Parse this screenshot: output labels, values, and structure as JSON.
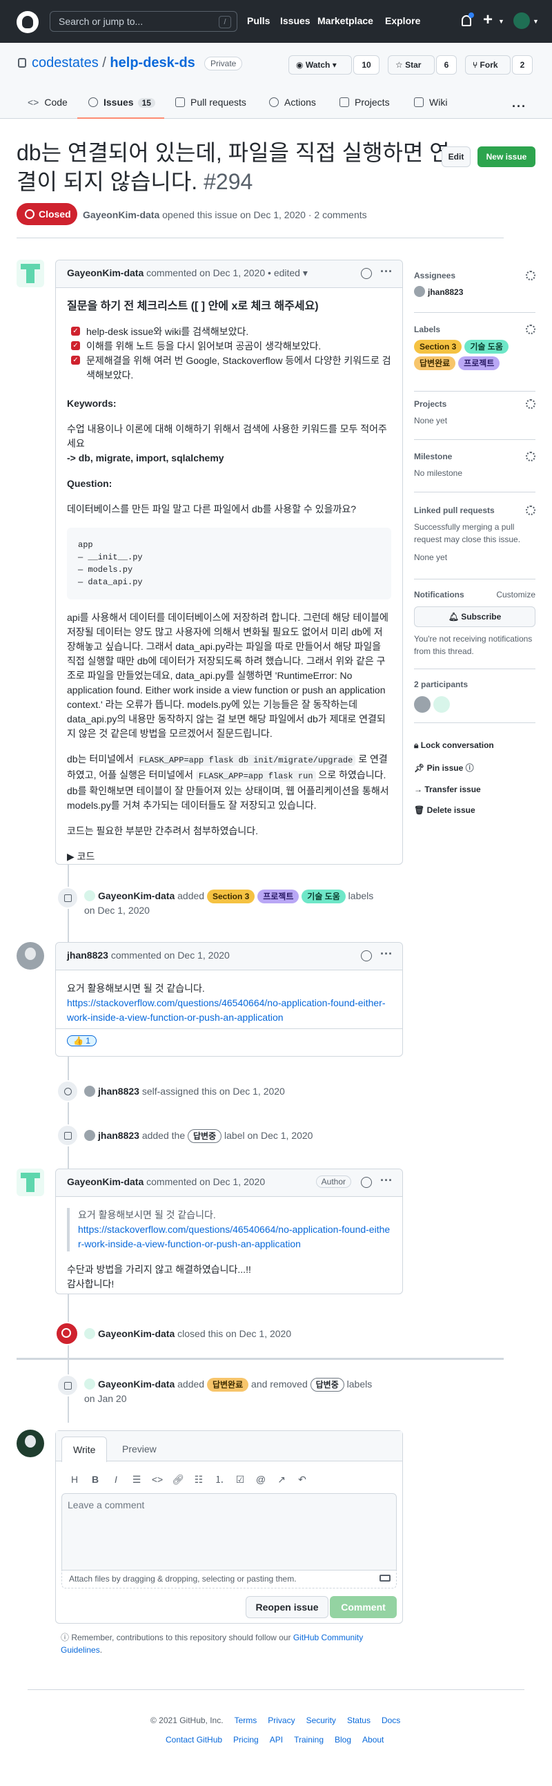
{
  "header": {
    "search_placeholder": "Search or jump to...",
    "slash": "/",
    "nav": [
      "Pulls",
      "Issues",
      "Marketplace",
      "Explore"
    ],
    "plus": "+"
  },
  "repo": {
    "owner": "codestates",
    "sep": "/",
    "name": "help-desk-ds",
    "visibility": "Private",
    "watch": "Watch",
    "watch_count": "10",
    "star": "Star",
    "star_count": "6",
    "fork": "Fork",
    "fork_count": "2"
  },
  "tabs": {
    "code": "Code",
    "issues": "Issues",
    "issues_count": "15",
    "pulls": "Pull requests",
    "actions": "Actions",
    "projects": "Projects",
    "wiki": "Wiki",
    "more": "···"
  },
  "issue": {
    "title": "db는 연결되어 있는데, 파일을 직접 실행하면 연결이 되지 않습니다.",
    "number": "#294",
    "edit": "Edit",
    "new_issue": "New issue",
    "state": "Closed",
    "author": "GayeonKim-data",
    "opened_text": "opened this issue on Dec 1, 2020 · 2 comments"
  },
  "c1": {
    "author": "GayeonKim-data",
    "meta": "commented on Dec 1, 2020 • edited ▾",
    "h": "질문을 하기 전 체크리스트 ([ ] 안에 x로 체크 해주세요)",
    "checks": [
      "help-desk issue와 wiki를 검색해보았다.",
      "이해를 위해 노트 등을 다시 읽어보며 공곰이 생각해보았다.",
      "문제해결을 위해 여러 번 Google, Stackoverflow 등에서 다양한 키워드로 검색해보았다."
    ],
    "kw_label": "Keywords:",
    "kw_text": "수업 내용이나 이론에 대해 이해하기 위해서 검색에 사용한 키워드를 모두 적어주세요",
    "kw_values": "-> db, migrate, import, sqlalchemy",
    "q_label": "Question:",
    "q_text": "데이터베이스를 만든 파일 말고 다른 파일에서 db를 사용할 수 있을까요?",
    "code": "app\n— __init__.py\n— models.py\n— data_api.py",
    "para1": "api를 사용해서 데이터를 데이터베이스에 저장하려 합니다. 그런데 해당 테이블에 저장될 데이터는 양도 많고 사용자에 의해서 변화될 필요도 없어서 미리 db에 저장해놓고 싶습니다. 그래서 data_api.py라는 파일을 따로 만들어서 해당 파일을 직접 실행할 때만 db에 데이터가 저장되도록 하려 했습니다. 그래서 위와 같은 구조로 파일을 만들었는데요, data_api.py를 실행하면 'RuntimeError: No application found. Either work inside a view function or push an application context.' 라는 오류가 뜹니다. models.py에 있는 기능들은 잘 동작하는데 data_api.py의 내용만 동작하지 않는 걸 보면 해당 파일에서 db가 제대로 연결되지 않은 것 같은데 방법을 모르겠어서 질문드립니다.",
    "p2a": "db는 터미널에서",
    "p2code1": "FLASK_APP=app flask db init/migrate/upgrade",
    "p2b": "로 연결하였고, 어플 실행은 터미널에서",
    "p2code2": "FLASK_APP=app flask run",
    "p2c": "으로 하였습니다. db를 확인해보면 테이블이 잘 만들어져 있는 상태이며, 웹 어플리케이션을 통해서 models.py를 거쳐 추가되는 데이터들도 잘 저장되고 있습니다.",
    "p3": "코드는 필요한 부분만 간추려서 첨부하였습니다.",
    "details": "▶ 코드"
  },
  "sidebar": {
    "assignees": "Assignees",
    "assignee": "jhan8823",
    "labels": "Labels",
    "label_list": [
      {
        "text": "Section 3",
        "bg": "#f5c242",
        "fg": "#3d2c00"
      },
      {
        "text": "기술 도움",
        "bg": "#6ee7c8",
        "fg": "#0b3d2e"
      },
      {
        "text": "답변완료",
        "bg": "#f7c56b",
        "fg": "#3d2c00"
      },
      {
        "text": "프로젝트",
        "bg": "#b9a7f5",
        "fg": "#2a1a66"
      }
    ],
    "projects": "Projects",
    "projects_val": "None yet",
    "milestone": "Milestone",
    "milestone_val": "No milestone",
    "linked": "Linked pull requests",
    "linked_desc": "Successfully merging a pull request may close this issue.",
    "linked_val": "None yet",
    "notifications": "Notifications",
    "customize": "Customize",
    "subscribe": "Subscribe",
    "notif_desc": "You're not receiving notifications from this thread.",
    "participants": "2 participants",
    "lock": "Lock conversation",
    "pin": "Pin issue",
    "transfer": "Transfer issue",
    "delete": "Delete issue"
  },
  "ev1": {
    "author": "GayeonKim-data",
    "added": "added",
    "labels": [
      "Section 3",
      "프로젝트",
      "기술 도움"
    ],
    "suffix": "labels",
    "date": "on Dec 1, 2020"
  },
  "c2": {
    "author": "jhan8823",
    "meta": "commented on Dec 1, 2020",
    "text": "요거 활용해보시면 될 것 같습니다.",
    "link": "https://stackoverflow.com/questions/46540664/no-application-found-either-work-inside-a-view-function-or-push-an-application",
    "reaction": "👍",
    "reaction_count": "1"
  },
  "ev2": {
    "author": "jhan8823",
    "text": "self-assigned this on Dec 1, 2020"
  },
  "ev3": {
    "author": "jhan8823",
    "pre": "added the",
    "label": "답변중",
    "post": "label on Dec 1, 2020"
  },
  "c3": {
    "author": "GayeonKim-data",
    "meta": "commented on Dec 1, 2020",
    "badge": "Author",
    "quote": "요거 활용해보시면 될 것 같습니다.",
    "link": "https://stackoverflow.com/questions/46540664/no-application-found-either-work-inside-a-view-function-or-push-an-application",
    "line1": "수단과 방법을 가리지 않고 해결하였습니다...!!",
    "line2": "감사합니다!"
  },
  "ev4": {
    "author": "GayeonKim-data",
    "text": "closed this on Dec 1, 2020"
  },
  "ev5": {
    "author": "GayeonKim-data",
    "added": "added",
    "label_add": "답변완료",
    "mid": "and removed",
    "label_rm": "답변중",
    "suffix": "labels",
    "date": "on Jan 20"
  },
  "editor": {
    "write": "Write",
    "preview": "Preview",
    "placeholder": "Leave a comment",
    "attach": "Attach files by dragging & dropping, selecting or pasting them.",
    "reopen": "Reopen issue",
    "comment": "Comment"
  },
  "remember": {
    "text": "Remember, contributions to this repository should follow our",
    "link": "GitHub Community Guidelines",
    "end": "."
  },
  "footer": {
    "copy": "© 2021 GitHub, Inc.",
    "row1": [
      "Terms",
      "Privacy",
      "Security",
      "Status",
      "Docs"
    ],
    "row2": [
      "Contact GitHub",
      "Pricing",
      "API",
      "Training",
      "Blog",
      "About"
    ]
  }
}
